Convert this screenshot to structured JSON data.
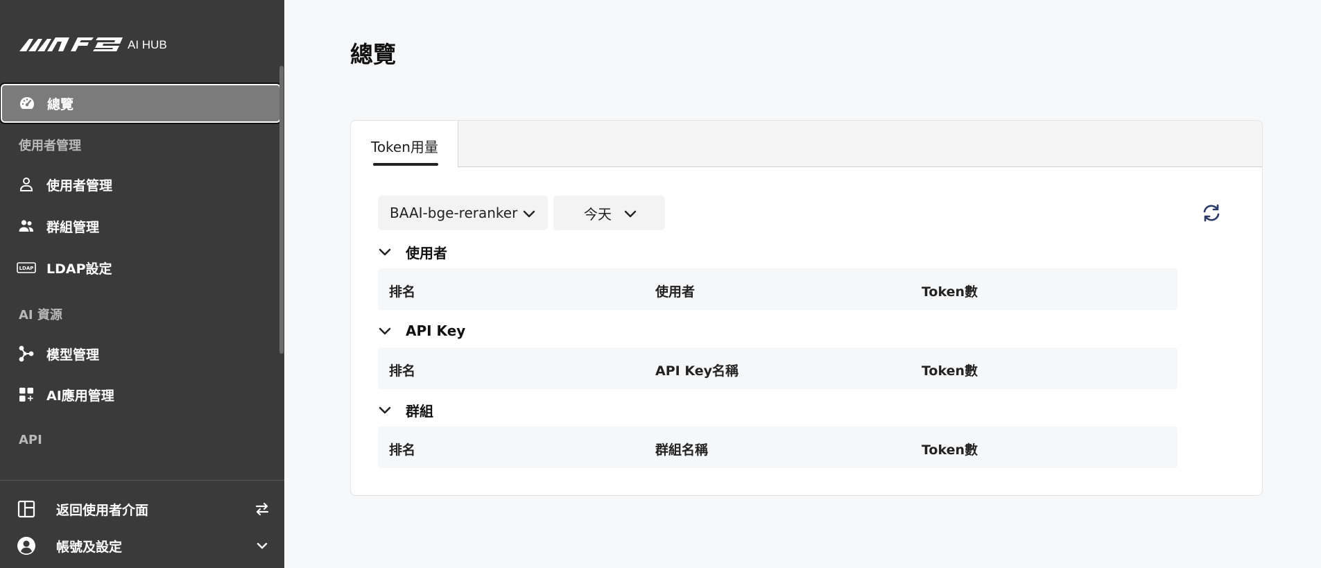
{
  "sidebar": {
    "logo_sub": "AI HUB",
    "items": [
      {
        "label": "總覽",
        "icon": "speedometer-icon"
      },
      {
        "label": "使用者管理",
        "icon": "user-icon"
      },
      {
        "label": "群組管理",
        "icon": "users-icon"
      },
      {
        "label": "LDAP設定",
        "icon": "ldap-icon"
      },
      {
        "label": "模型管理",
        "icon": "model-network-icon"
      },
      {
        "label": "AI應用管理",
        "icon": "apps-add-icon"
      }
    ],
    "sections": [
      "使用者管理",
      "AI 資源",
      "API"
    ],
    "bottom": {
      "back_label": "返回使用者介面",
      "account_label": "帳號及設定"
    },
    "ldap_icon_text": "LDAP"
  },
  "main": {
    "title": "總覽",
    "tab_label": "Token用量",
    "model_select": "BAAI-bge-reranker",
    "range_select": "今天",
    "groups": [
      {
        "title": "使用者",
        "columns": [
          "排名",
          "使用者",
          "Token數"
        ]
      },
      {
        "title": "API Key",
        "columns": [
          "排名",
          "API Key名稱",
          "Token數"
        ]
      },
      {
        "title": "群組",
        "columns": [
          "排名",
          "群組名稱",
          "Token數"
        ]
      }
    ]
  },
  "colors": {
    "sidebar_bg": "#3a3a3a",
    "active_item_bg": "#7b7b7b",
    "refresh_icon": "#2b3a67"
  }
}
